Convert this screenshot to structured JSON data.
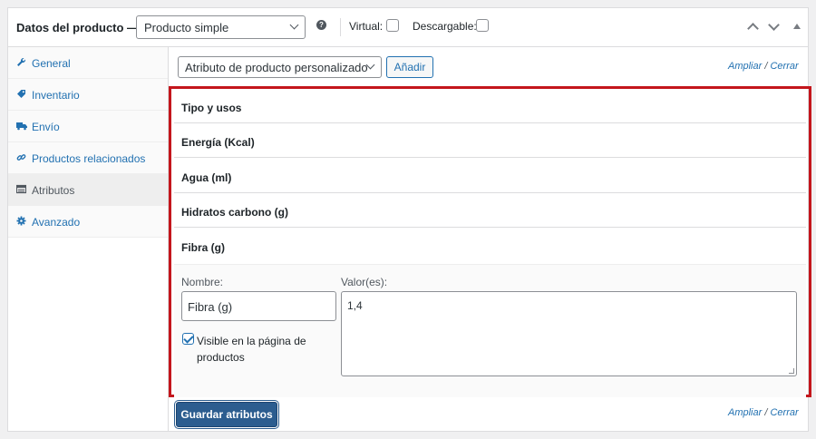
{
  "header": {
    "title": "Datos del producto —",
    "product_type": "Producto simple",
    "help_icon": "help-icon",
    "virtual_label": "Virtual:",
    "downloadable_label": "Descargable:"
  },
  "sidebar": {
    "items": [
      {
        "label": "General",
        "icon": "wrench-icon",
        "active": false
      },
      {
        "label": "Inventario",
        "icon": "tag-icon",
        "active": false
      },
      {
        "label": "Envío",
        "icon": "truck-icon",
        "active": false
      },
      {
        "label": "Productos relacionados",
        "icon": "link-icon",
        "active": false
      },
      {
        "label": "Atributos",
        "icon": "table-icon",
        "active": true
      },
      {
        "label": "Avanzado",
        "icon": "gear-icon",
        "active": false
      }
    ]
  },
  "toolbar": {
    "attribute_select": "Atributo de producto personalizado",
    "add_label": "Añadir",
    "expand_label": "Ampliar",
    "separator": "/",
    "close_label": "Cerrar"
  },
  "attributes": {
    "rows": [
      "Tipo y usos",
      "Energía (Kcal)",
      "Agua (ml)",
      "Hidratos carbono (g)",
      "Fibra (g)"
    ],
    "edit": {
      "name_label": "Nombre:",
      "name_value": "Fibra (g)",
      "values_label": "Valor(es):",
      "values_value": "1,4",
      "visible_label": "Visible en la página de productos",
      "visible_checked": true
    }
  },
  "footer": {
    "save_label": "Guardar atributos",
    "expand_label": "Ampliar",
    "separator": "/",
    "close_label": "Cerrar"
  },
  "colors": {
    "accent": "#2271b1",
    "highlight_border": "#c4161c",
    "primary_button": "#2c5d8f"
  }
}
